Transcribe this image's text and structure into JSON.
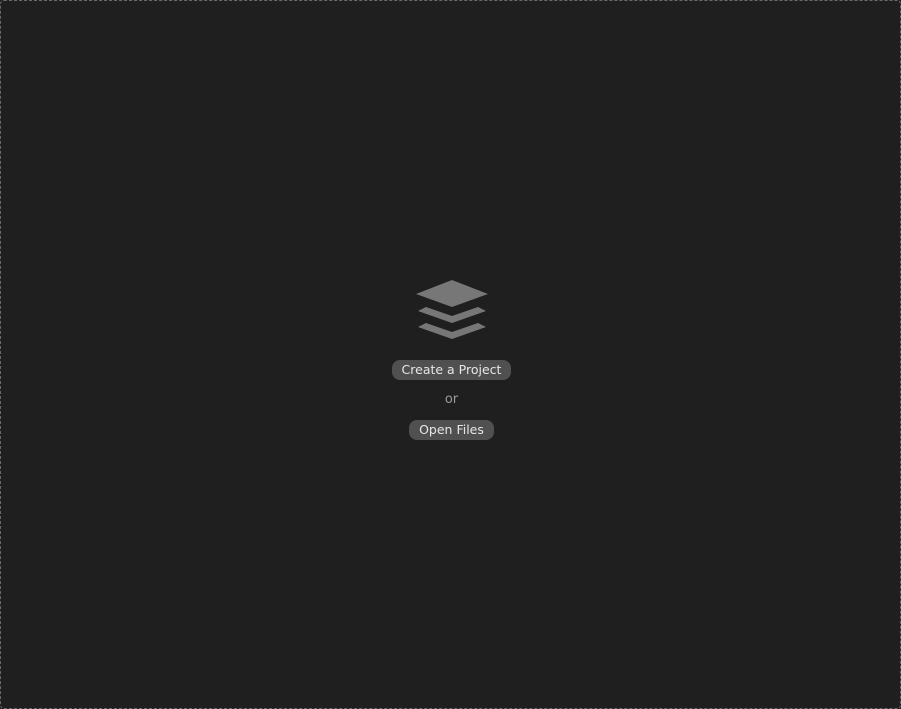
{
  "empty_state": {
    "icon": "layers-icon",
    "create_label": "Create a Project",
    "or_label": "or",
    "open_label": "Open Files"
  },
  "colors": {
    "background": "#1f1f1f",
    "border": "#6a6a6a",
    "icon": "#777777",
    "button_bg": "#505050",
    "button_text": "#e6e6e6",
    "muted_text": "#9a9a9a"
  }
}
